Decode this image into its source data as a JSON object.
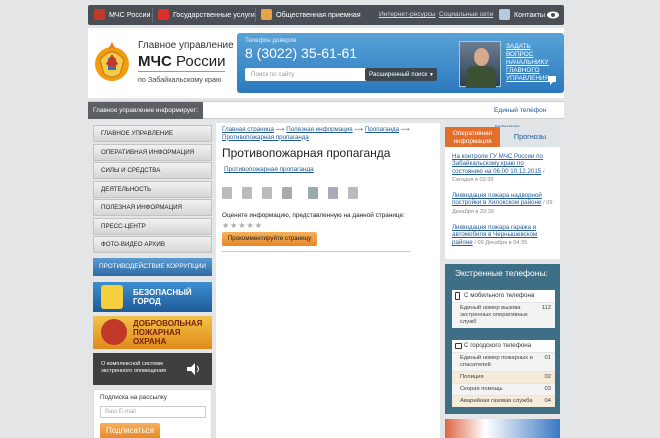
{
  "topbar": {
    "items": [
      "МЧС России",
      "Государственные услуги",
      "Общественная приемная"
    ],
    "links": [
      "Интернет-ресурсы",
      "Социальные сети"
    ],
    "contacts": "Контакты"
  },
  "header": {
    "line1": "Главное управление",
    "line2_bold": "МЧС",
    "line2_rest": " России",
    "line3": "по Забайкальскому краю",
    "phone_label": "Телефон доверия",
    "phone": "8 (3022) 35-61-61",
    "search_placeholder": "Поиск по сайту",
    "advanced_search": "Расширенный поиск",
    "ask_question": "ЗАДАТЬ ВОПРОС НАЧАЛЬНИКУ ГЛАВНОГО УПРАВЛЕНИЯ"
  },
  "ticker": {
    "label": "Главное управление информирует:",
    "text": "Единый телефон доверия"
  },
  "nav": {
    "items": [
      "Главное управление",
      "Оперативная информация",
      "Силы и средства",
      "Деятельность",
      "Полезная информация",
      "Пресс-центр",
      "Фото-видео архив"
    ]
  },
  "banners": {
    "corruption": "ПРОТИВОДЕЙСТВИЕ КОРРУПЦИИ",
    "safe_city": [
      "БЕЗОПАСНЫЙ",
      "ГОРОД"
    ],
    "fire_guard": [
      "ДОБРОВОЛЬНАЯ",
      "ПОЖАРНАЯ",
      "ОХРАНА"
    ],
    "alert_system": "О комплексной системе экстренного оповещения"
  },
  "subscribe": {
    "title": "Подписка на рассылку",
    "placeholder": "Ваш E-mail",
    "button": "Подписаться"
  },
  "breadcrumbs": [
    "Главная страница",
    "Полезная информация",
    "Пропаганда",
    "Противопожарная пропаганда"
  ],
  "page": {
    "title": "Противопожарная пропаганда",
    "link": "Противопожарная пропаганда",
    "rate_text": "Оцените информацию, представленную на данной странице:",
    "stars": "★★★★★",
    "comment_button": "Прокомментируйте страницу"
  },
  "right_tabs": {
    "tab1": "Оперативная информация",
    "tab2": "Прогнозы"
  },
  "news": [
    {
      "text": "На контроле ГУ МЧС России по Забайкальскому краю по состоянию на 06.00 10.12.2015",
      "date": "/ Сегодня в 02:39"
    },
    {
      "text": "Ликвидация пожара надворной постройки в Хилокском районе",
      "date": "/ 09 Декабря в 23:39"
    },
    {
      "text": "Ликвидация пожара гаража и автомобиля в Чернышевском районе",
      "date": "/ 09 Декабря в 04:35"
    }
  ],
  "emergency": {
    "title": "Экстренные телефоны:",
    "mobile_header": "С мобильного телефона",
    "mobile_rows": [
      {
        "name": "Единый номер вызова экстренных оперативных служб",
        "number": "112"
      }
    ],
    "city_header": "С городского телефона",
    "city_rows": [
      {
        "name": "Единый номер пожарных и спасателей",
        "number": "01"
      },
      {
        "name": "Полиция",
        "number": "02"
      },
      {
        "name": "Скорая помощь",
        "number": "03"
      },
      {
        "name": "Аварийная газовая служба",
        "number": "04"
      }
    ]
  },
  "colors": {
    "accent": "#e26f2b",
    "blue": "#2b78bd",
    "link": "#1f5a98"
  }
}
